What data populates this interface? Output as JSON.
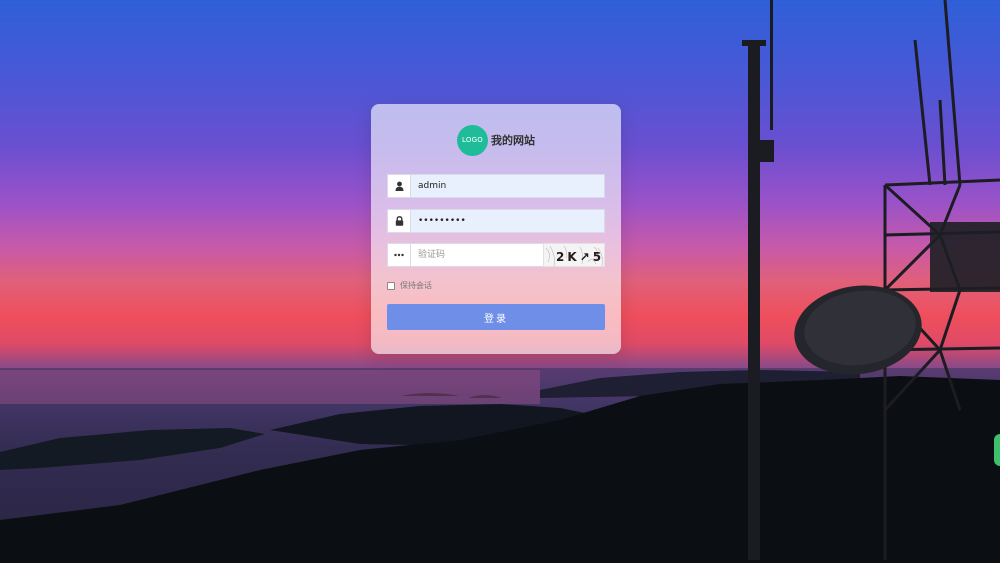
{
  "brand": {
    "logo_text": "LOGO",
    "site_name": "我的网站"
  },
  "form": {
    "username": {
      "value": "admin",
      "icon": "user-icon"
    },
    "password": {
      "value": "•••••••••",
      "icon": "lock-icon"
    },
    "captcha": {
      "placeholder": "验证码",
      "icon": "dots-icon",
      "image_text": "2K↗5"
    },
    "remember": {
      "label": "保持会话",
      "checked": false
    },
    "submit_label": "登录"
  },
  "colors": {
    "accent": "#6f8ee8",
    "logo": "#1fbc9a"
  }
}
